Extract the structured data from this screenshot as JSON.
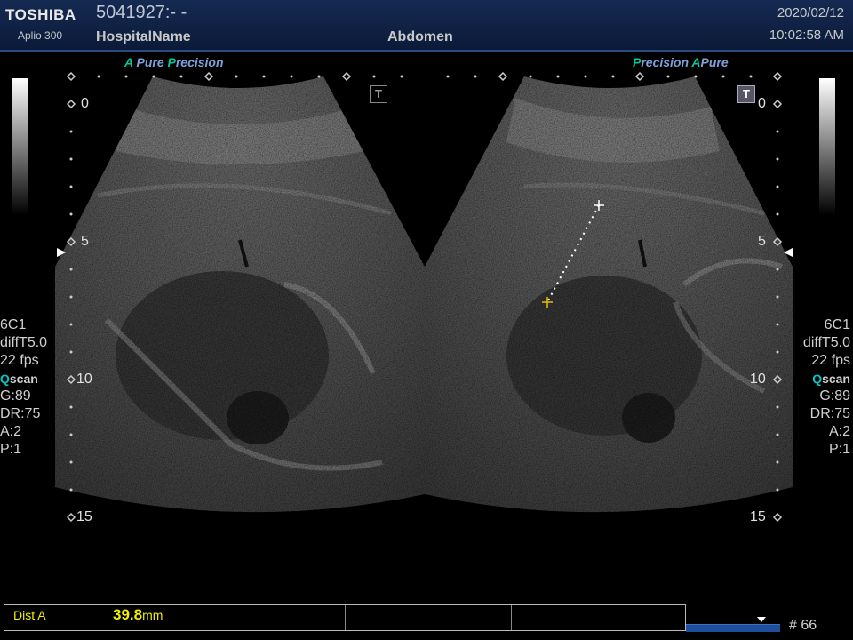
{
  "header": {
    "brand": "TOSHIBA",
    "model": "Aplio 300",
    "patient_id": "5041927:- -",
    "hospital": "HospitalName",
    "exam": "Abdomen",
    "date": "2020/02/12",
    "time": "10:02:58 AM"
  },
  "left_panel": {
    "mode_a": "A",
    "mode_pure": " Pure ",
    "mode_p": "P",
    "mode_precision": "recision",
    "t_mark": "T",
    "depth": {
      "d0": "0",
      "d5": "5",
      "d10": "10",
      "d15": "15"
    },
    "params": {
      "probe": "6C1",
      "harmonic": "diffT5.0",
      "fps": "22 fps",
      "q_prefix": "Q",
      "q_rest": "scan",
      "gain": "G:89",
      "dr": "DR:75",
      "a": "A:2",
      "p": "P:1"
    }
  },
  "right_panel": {
    "mode_p": "P",
    "mode_precision": "recision ",
    "mode_a": "A",
    "mode_pure": "Pure",
    "t_mark": "T",
    "depth": {
      "d0": "0",
      "d5": "5",
      "d10": "10",
      "d15": "15"
    },
    "params": {
      "probe": "6C1",
      "harmonic": "diffT5.0",
      "fps": "22 fps",
      "q_prefix": "Q",
      "q_rest": "scan",
      "gain": "G:89",
      "dr": "DR:75",
      "a": "A:2",
      "p": "P:1"
    }
  },
  "measurement": {
    "label": "Dist A",
    "value": "39.8",
    "unit": "mm"
  },
  "cine": {
    "frame": "# 66"
  },
  "colors": {
    "accent_teal": "#00c8a0",
    "measure_yellow": "#f0f000",
    "header_blue": "#152a52"
  }
}
